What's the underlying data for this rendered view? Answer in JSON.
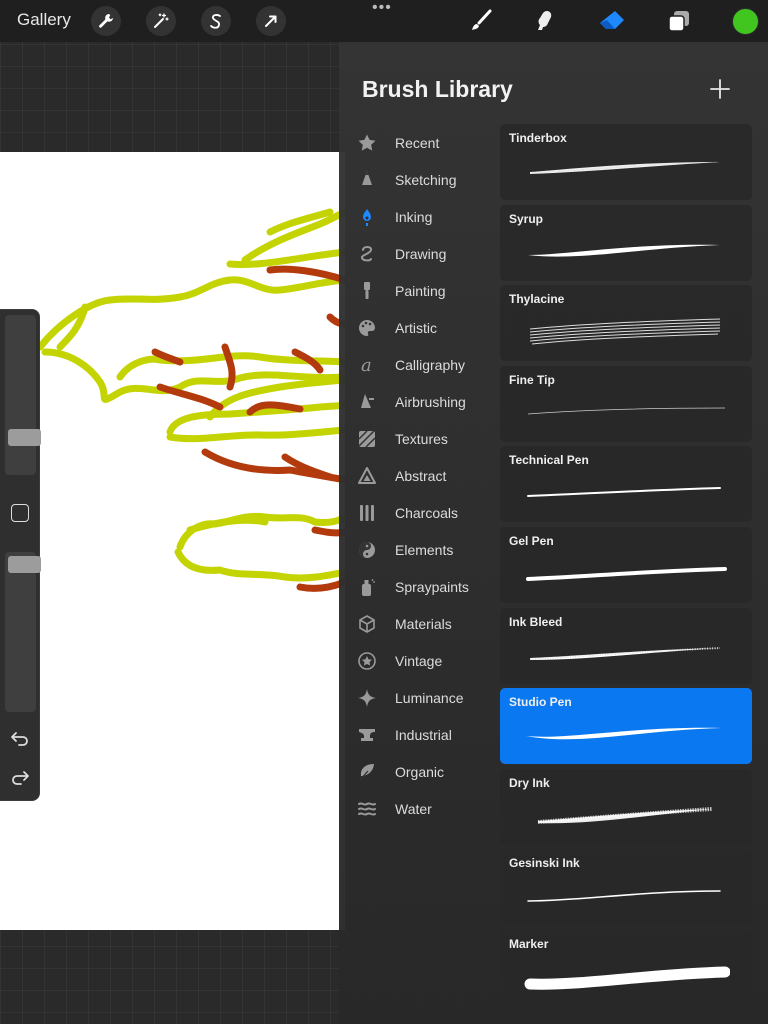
{
  "topbar": {
    "gallery_label": "Gallery",
    "actions_icon": "wrench-icon",
    "adjustments_icon": "magic-wand-icon",
    "selection_icon": "selection-s-icon",
    "transform_icon": "arrow-cursor-icon",
    "more_icon": "ellipsis-icon",
    "more_label": "•••",
    "brush_icon": "brush-icon",
    "smudge_icon": "smudge-icon",
    "eraser_icon": "eraser-icon",
    "layers_icon": "layers-icon",
    "current_color": "#41c61f"
  },
  "sidebar": {
    "size_slider_level": 0.2,
    "opacity_slider_level": 0.97
  },
  "brush_library": {
    "title": "Brush Library",
    "add_icon": "plus-icon",
    "categories": [
      {
        "label": "Recent",
        "icon": "star-icon",
        "active": false
      },
      {
        "label": "Sketching",
        "icon": "pencil-tip-icon",
        "active": false
      },
      {
        "label": "Inking",
        "icon": "ink-drop-icon",
        "active": true
      },
      {
        "label": "Drawing",
        "icon": "squiggle-icon",
        "active": false
      },
      {
        "label": "Painting",
        "icon": "paintbrush-icon",
        "active": false
      },
      {
        "label": "Artistic",
        "icon": "palette-icon",
        "active": false
      },
      {
        "label": "Calligraphy",
        "icon": "calligraphy-a-icon",
        "active": false
      },
      {
        "label": "Airbrushing",
        "icon": "airbrush-icon",
        "active": false
      },
      {
        "label": "Textures",
        "icon": "hatch-square-icon",
        "active": false
      },
      {
        "label": "Abstract",
        "icon": "triangle-icon",
        "active": false
      },
      {
        "label": "Charcoals",
        "icon": "charcoal-sticks-icon",
        "active": false
      },
      {
        "label": "Elements",
        "icon": "yin-yang-icon",
        "active": false
      },
      {
        "label": "Spraypaints",
        "icon": "spray-can-icon",
        "active": false
      },
      {
        "label": "Materials",
        "icon": "cube-icon",
        "active": false
      },
      {
        "label": "Vintage",
        "icon": "star-badge-icon",
        "active": false
      },
      {
        "label": "Luminance",
        "icon": "sparkle-icon",
        "active": false
      },
      {
        "label": "Industrial",
        "icon": "anvil-icon",
        "active": false
      },
      {
        "label": "Organic",
        "icon": "leaf-icon",
        "active": false
      },
      {
        "label": "Water",
        "icon": "waves-icon",
        "active": false
      }
    ],
    "brushes": [
      {
        "name": "Tinderbox",
        "selected": false,
        "stroke": "tinderbox"
      },
      {
        "name": "Syrup",
        "selected": false,
        "stroke": "syrup"
      },
      {
        "name": "Thylacine",
        "selected": false,
        "stroke": "thylacine"
      },
      {
        "name": "Fine Tip",
        "selected": false,
        "stroke": "finetip"
      },
      {
        "name": "Technical Pen",
        "selected": false,
        "stroke": "technical"
      },
      {
        "name": "Gel Pen",
        "selected": false,
        "stroke": "gelpen"
      },
      {
        "name": "Ink Bleed",
        "selected": false,
        "stroke": "inkbleed"
      },
      {
        "name": "Studio Pen",
        "selected": true,
        "stroke": "studiopen"
      },
      {
        "name": "Dry Ink",
        "selected": false,
        "stroke": "dryink"
      },
      {
        "name": "Gesinski Ink",
        "selected": false,
        "stroke": "gesinski"
      },
      {
        "name": "Marker",
        "selected": false,
        "stroke": "marker"
      }
    ]
  },
  "canvas": {
    "stroke_colors": {
      "green": "#c3d402",
      "brown": "#b23a0c"
    }
  },
  "colors": {
    "accent": "#0a78f0",
    "active_category": "#1e88ff"
  }
}
